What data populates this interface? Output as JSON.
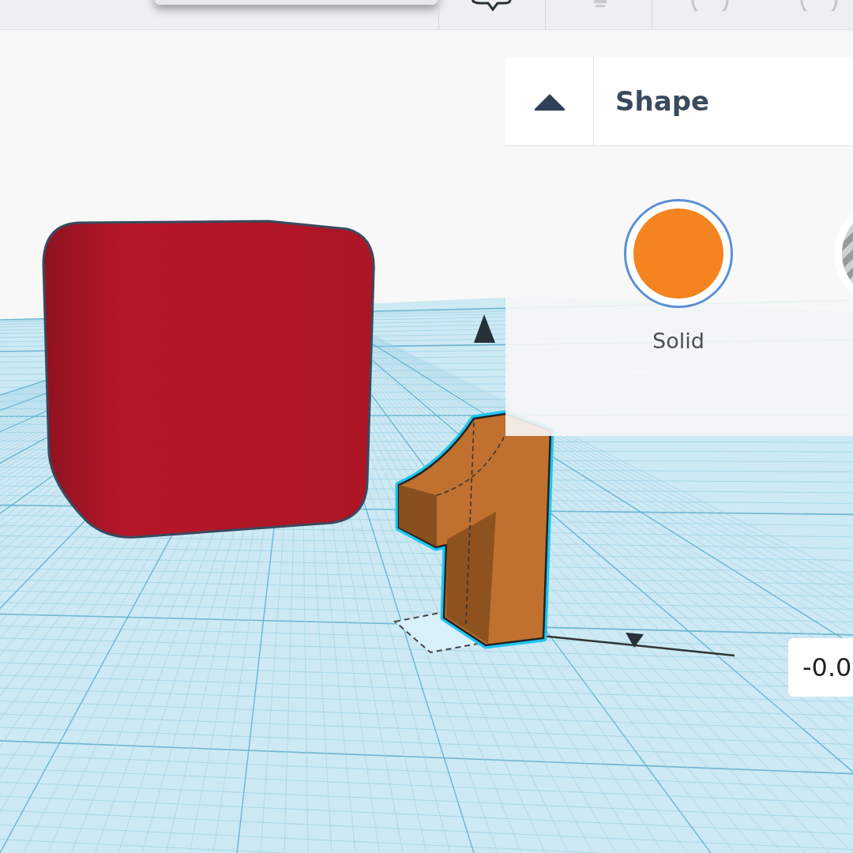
{
  "panel": {
    "title": "Shape",
    "expanded": true,
    "options": [
      {
        "label": "Solid",
        "color": "#f3841f",
        "selected": true
      }
    ]
  },
  "dimension_labels": [
    {
      "text": "-0.0"
    }
  ]
}
